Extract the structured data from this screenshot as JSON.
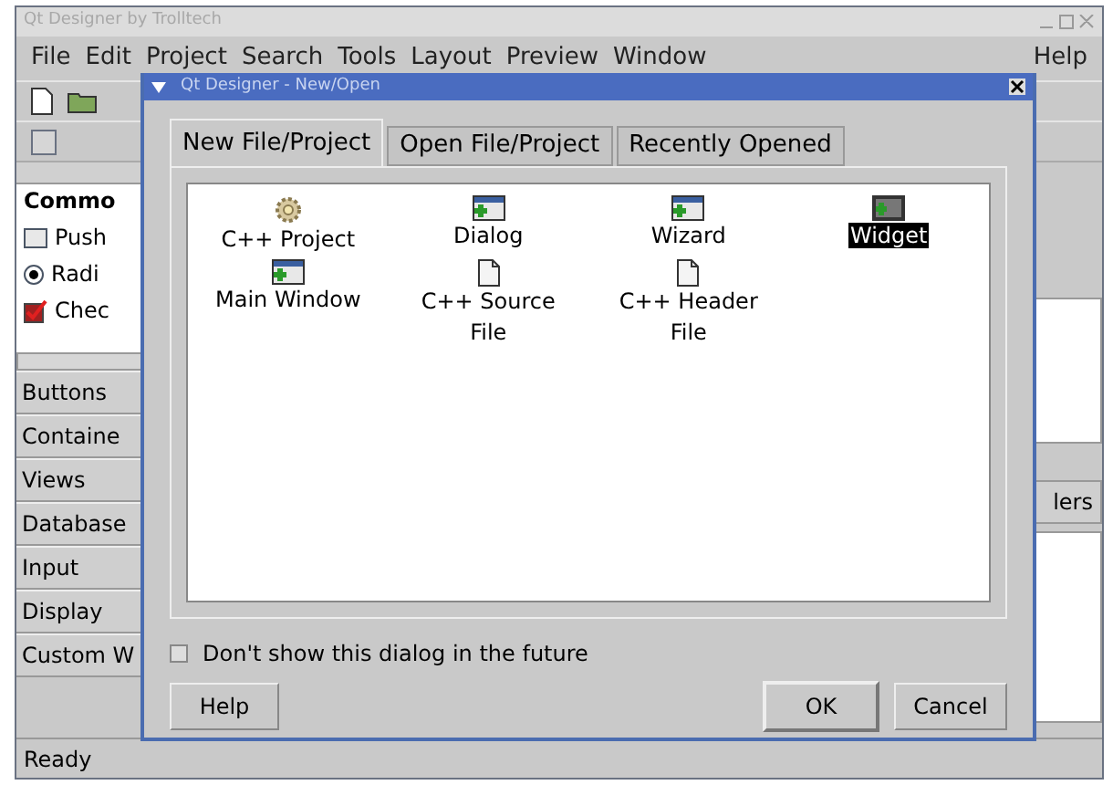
{
  "main_window": {
    "title": "Qt Designer by Trolltech",
    "menu": [
      "File",
      "Edit",
      "Project",
      "Search",
      "Tools",
      "Layout",
      "Preview",
      "Window"
    ],
    "help_menu": "Help",
    "toolbox": {
      "header": "Commo",
      "items": [
        {
          "label": "Push",
          "kind": "push"
        },
        {
          "label": "Radi",
          "kind": "radio"
        },
        {
          "label": "Chec",
          "kind": "check"
        }
      ],
      "categories": [
        "Buttons",
        "Containe",
        "Views",
        "Database",
        "Input",
        "Display",
        "Custom W"
      ]
    },
    "right_panel": {
      "button": "lers"
    },
    "status_bar": "Ready"
  },
  "dialog": {
    "title": "Qt Designer - New/Open",
    "tabs": [
      {
        "label": "New File/Project",
        "selected": true
      },
      {
        "label": "Open File/Project",
        "selected": false
      },
      {
        "label": "Recently Opened",
        "selected": false
      }
    ],
    "items": [
      {
        "label": "C++ Project",
        "kind": "gear",
        "selected": false
      },
      {
        "label": "Dialog",
        "kind": "window",
        "selected": false
      },
      {
        "label": "Wizard",
        "kind": "window",
        "selected": false
      },
      {
        "label": "Widget",
        "kind": "widget",
        "selected": true
      },
      {
        "label": "Main Window",
        "kind": "window",
        "selected": false
      },
      {
        "label": "C++ Source File",
        "kind": "file",
        "selected": false
      },
      {
        "label": "C++ Header File",
        "kind": "file",
        "selected": false
      }
    ],
    "dont_show": {
      "label": "Don't show this dialog in the future",
      "checked": false
    },
    "buttons": {
      "help": "Help",
      "ok": "OK",
      "cancel": "Cancel"
    }
  }
}
